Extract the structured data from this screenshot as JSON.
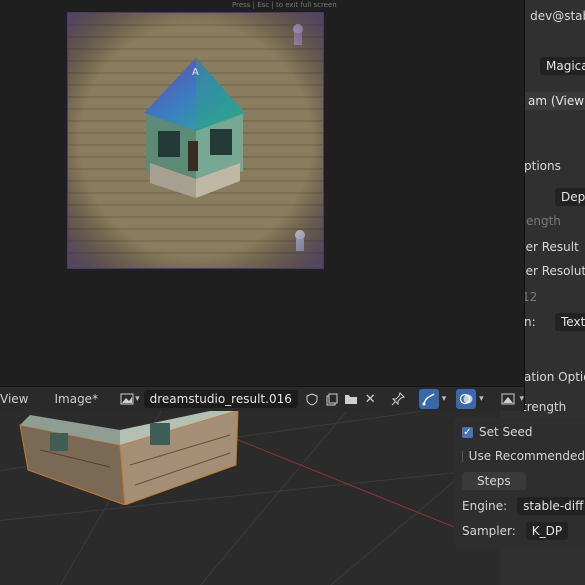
{
  "image_editor": {
    "hint_text": "Press | Esc | to exit full screen",
    "header": {
      "menu_view": "View",
      "menu_image": "Image*",
      "image_name": "dreamstudio_result.016"
    }
  },
  "right_panel": {
    "user_text": "s: dev@stabl",
    "model_value": "Magica",
    "source_text": "am (Viewpo",
    "options_label": "ptions",
    "depth_value": "Dept",
    "strength_label": "ength",
    "render_result_label": "der Result",
    "render_resolution_label": "der Resolutio",
    "resolution_value": "12",
    "texture_label": "t In:",
    "texture_value": "Textu",
    "animation_options_label": "ation Option",
    "strength2_label": "trength"
  },
  "sd_panel": {
    "set_seed_label": "Set Seed",
    "set_seed_checked": true,
    "use_recommended_label": "Use Recommended",
    "use_recommended_checked": false,
    "steps_label": "Steps",
    "engine_label": "Engine:",
    "engine_value": "stable-diff",
    "sampler_label": "Sampler:",
    "sampler_value": "K_DP"
  },
  "colors": {
    "accent_blue": "#3b68a8",
    "panel_bg": "#303030",
    "editor_bg": "#1f1f1f"
  }
}
